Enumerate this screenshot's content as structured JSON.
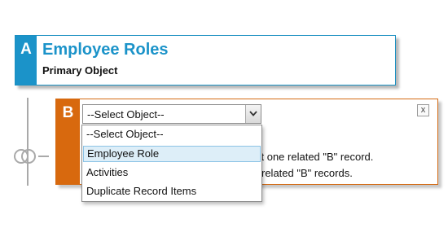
{
  "primary": {
    "letter": "A",
    "title": "Employee Roles",
    "subtitle": "Primary Object",
    "accent": "#1b93c9"
  },
  "related": {
    "letter": "B",
    "accent": "#d8690e",
    "close_label": "x",
    "description_line1": "st one related \"B\" record.",
    "description_line2": "related \"B\" records."
  },
  "object_select": {
    "selected": "--Select Object--",
    "icon": "chevron-down-icon",
    "options": [
      "--Select Object--",
      "Employee Role",
      "Activities",
      "Duplicate Record Items"
    ],
    "highlighted": "Employee Role",
    "highlight_color": "#ddeef8"
  },
  "connector": {
    "icon": "venn-rings-icon"
  }
}
